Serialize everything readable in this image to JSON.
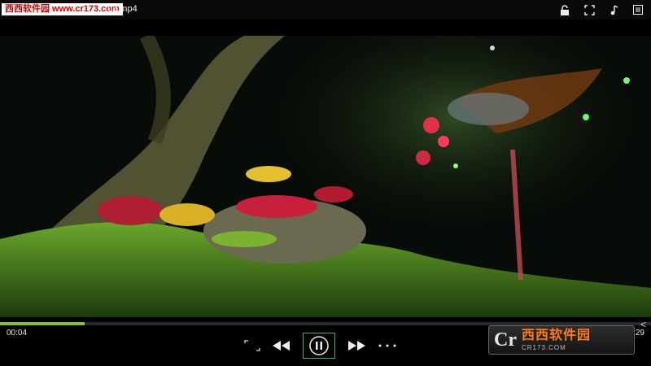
{
  "watermark": {
    "text": "西西软件园 www.cr173.com"
  },
  "file": {
    "name": "03.mp4"
  },
  "top_icons": [
    "lock-icon",
    "crop-icon",
    "music-note-icon",
    "menu-icon"
  ],
  "video": {
    "description_colors": {
      "moss": "#4f8f1f",
      "berry": "#c8203a",
      "gold": "#d9b024"
    }
  },
  "playback": {
    "elapsed": "00:04",
    "total": ":29",
    "progress_fraction": 0.13
  },
  "controls": [
    "fullscreen-corners-icon",
    "rewind-icon",
    "pause-icon",
    "forward-icon",
    "more-icon"
  ],
  "logo": {
    "mark": "Cr",
    "main": "西西软件园",
    "sub": "CR173.COM"
  },
  "colors": {
    "accent": "#2fb09a",
    "progress": "#7fc33a",
    "bg": "#000000"
  }
}
